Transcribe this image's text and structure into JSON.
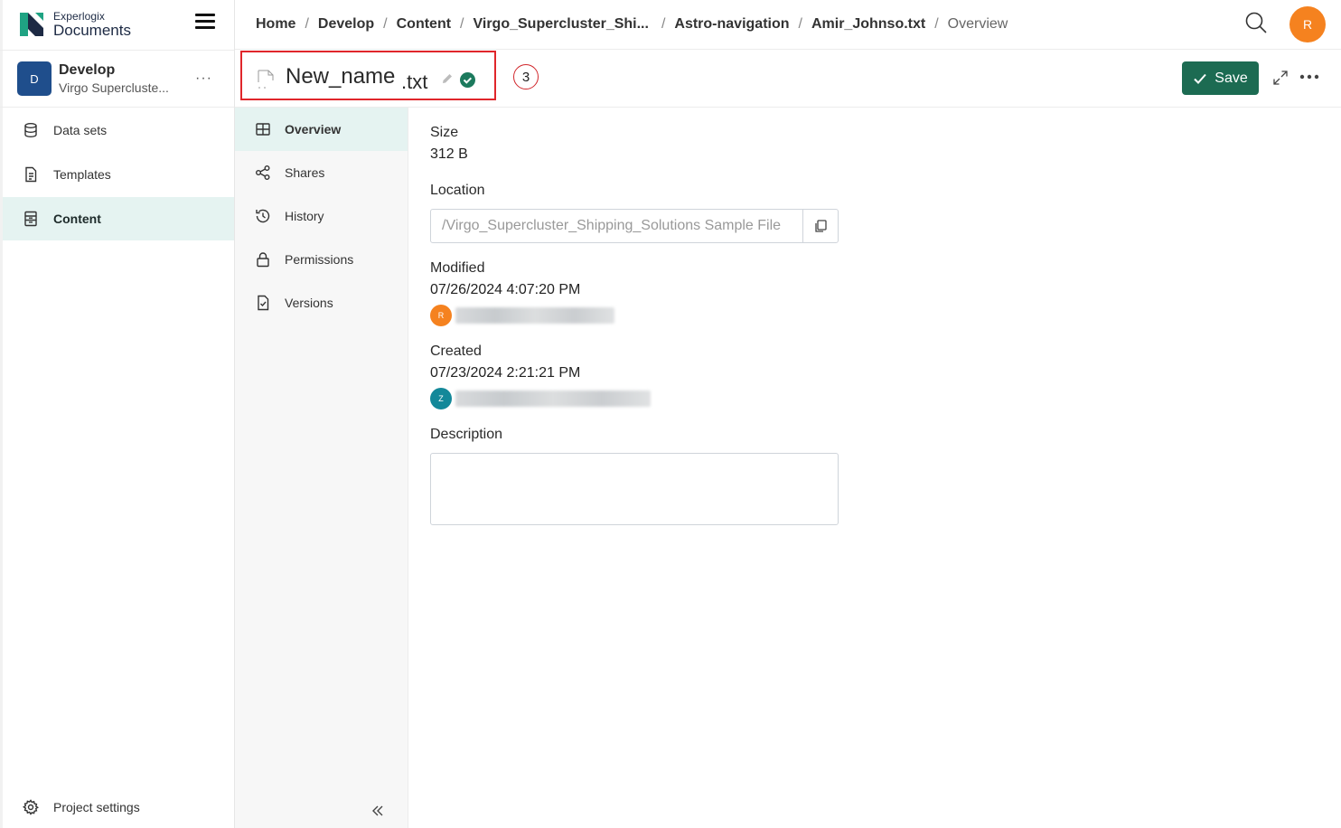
{
  "app": {
    "brand_line1": "Experlogix",
    "brand_line2": "Documents"
  },
  "project": {
    "initial": "D",
    "name": "Develop",
    "subtitle": "Virgo Supercluste..."
  },
  "sidebar": {
    "items": [
      {
        "label": "Data sets",
        "icon": "database-icon"
      },
      {
        "label": "Templates",
        "icon": "document-icon"
      },
      {
        "label": "Content",
        "icon": "content-icon",
        "active": true
      }
    ],
    "settings_label": "Project settings"
  },
  "breadcrumb": {
    "items": [
      "Home",
      "Develop",
      "Content",
      "Virgo_Supercluster_Shi...",
      "Astro-navigation",
      "Amir_Johnso.txt"
    ],
    "current": "Overview"
  },
  "user": {
    "initial": "R"
  },
  "file": {
    "name": "New_name",
    "extension": ".txt",
    "step_number": "3"
  },
  "actions": {
    "save_label": "Save"
  },
  "subnav": {
    "items": [
      {
        "label": "Overview",
        "active": true
      },
      {
        "label": "Shares"
      },
      {
        "label": "History"
      },
      {
        "label": "Permissions"
      },
      {
        "label": "Versions"
      }
    ]
  },
  "details": {
    "size_label": "Size",
    "size_value": "312 B",
    "location_label": "Location",
    "location_value": "/Virgo_Supercluster_Shipping_Solutions Sample File",
    "modified_label": "Modified",
    "modified_value": "07/26/2024 4:07:20 PM",
    "modified_user_initial": "R",
    "created_label": "Created",
    "created_value": "07/23/2024 2:21:21 PM",
    "created_user_initial": "Z",
    "description_label": "Description",
    "description_value": ""
  },
  "colors": {
    "accent": "#1c6b52",
    "active_bg": "#e5f3f1",
    "avatar_orange": "#f5821f",
    "avatar_teal": "#138899",
    "highlight_red": "#e0262b"
  }
}
